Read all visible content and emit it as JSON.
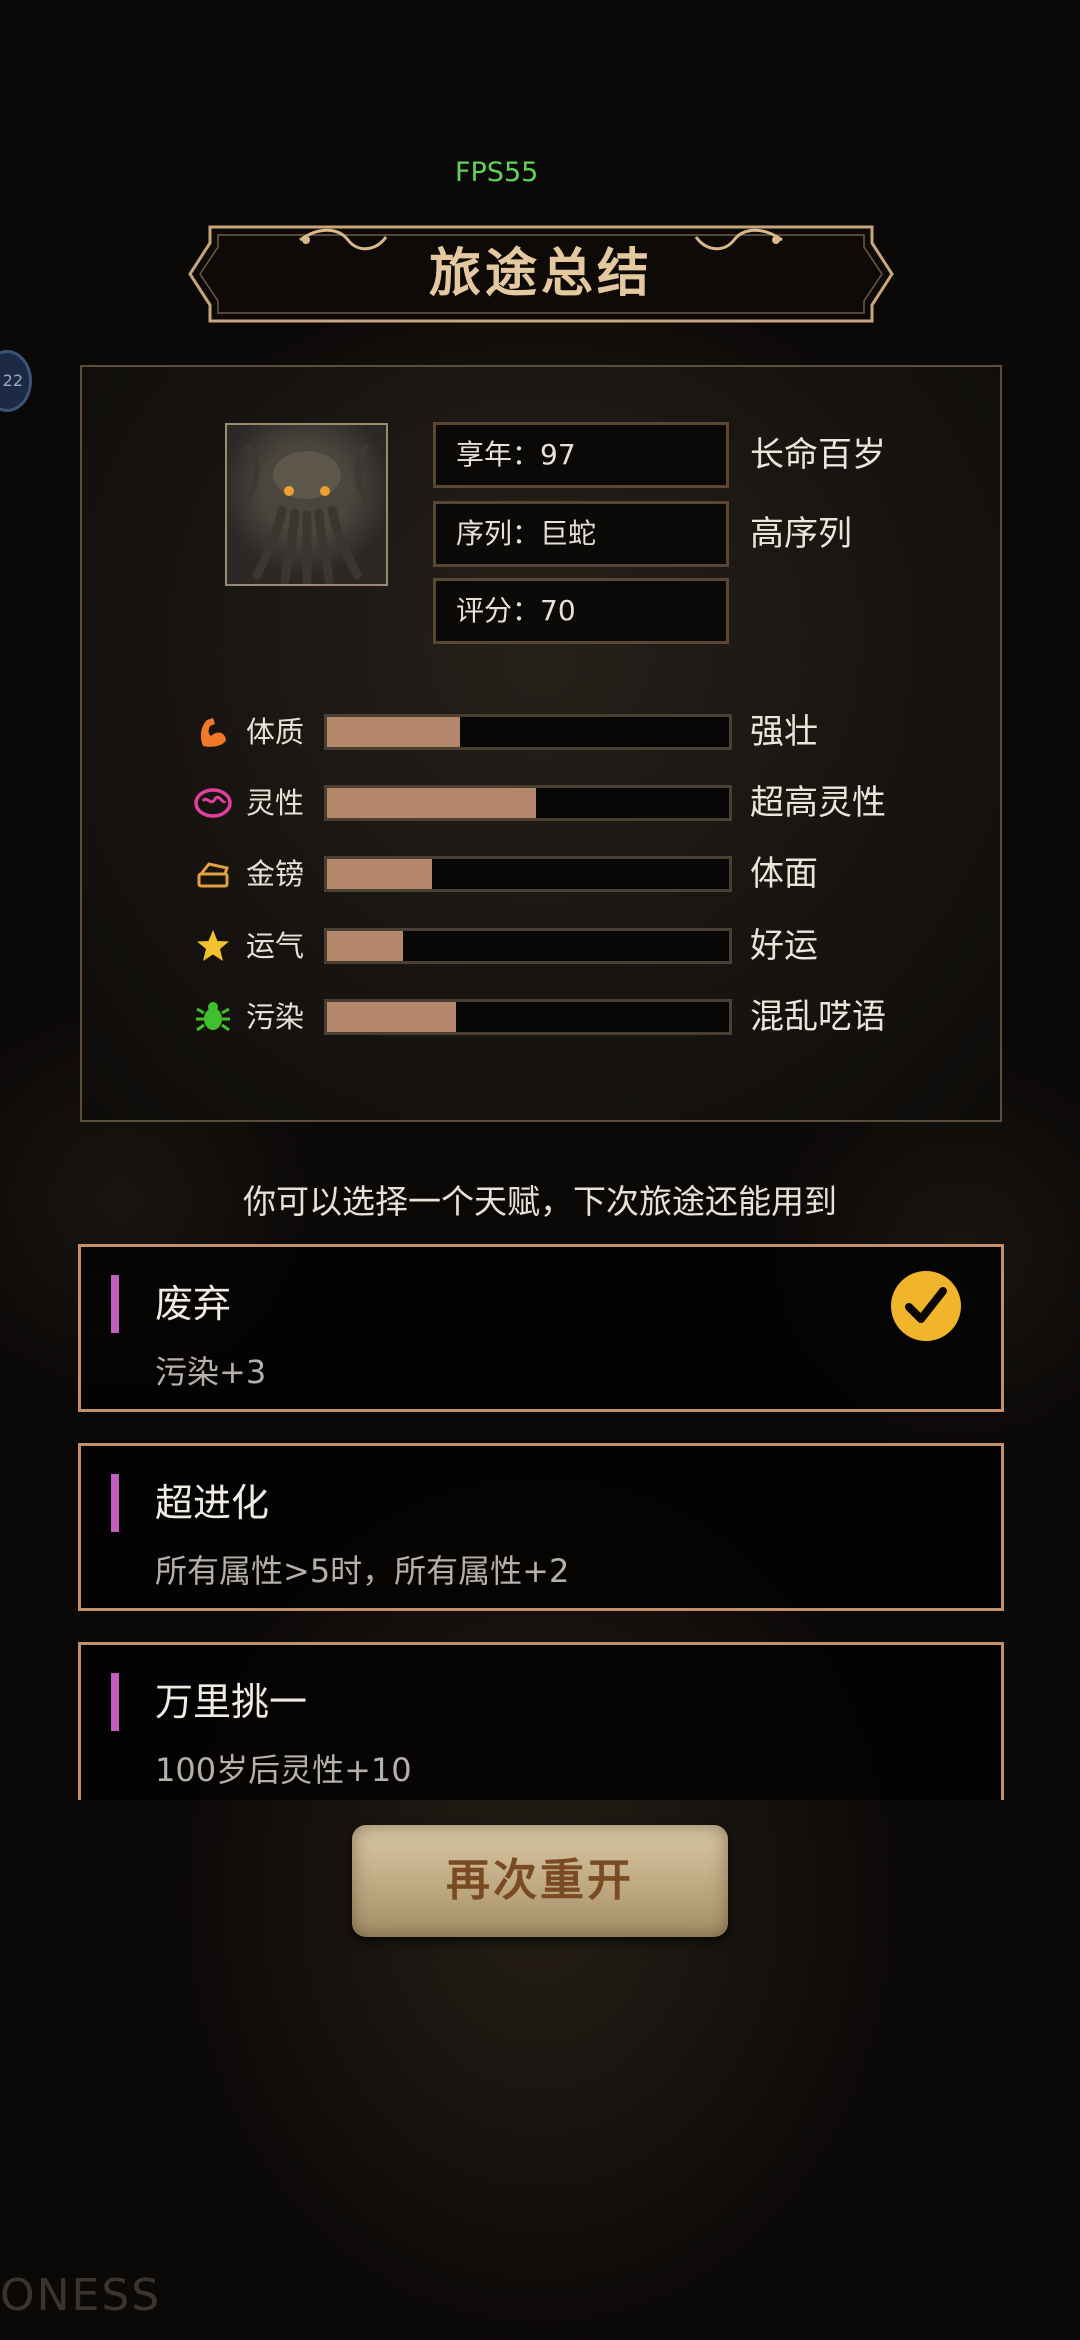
{
  "fps": "FPS55",
  "side_badge": "22",
  "title": "旅途总结",
  "summary": {
    "portrait_icon": "cthulhu-portrait",
    "info": [
      {
        "text": "享年：97",
        "tag": "长命百岁"
      },
      {
        "text": "序列：巨蛇",
        "tag": "高序列"
      },
      {
        "text": "评分：70",
        "tag": ""
      }
    ],
    "stats": [
      {
        "label": "体质",
        "icon": "muscle-icon",
        "icon_color": "#f07a2a",
        "fill": 0.33,
        "tag": "强壮"
      },
      {
        "label": "灵性",
        "icon": "brain-icon",
        "icon_color": "#e0409a",
        "fill": 0.52,
        "tag": "超高灵性"
      },
      {
        "label": "金镑",
        "icon": "money-icon",
        "icon_color": "#e0a040",
        "fill": 0.26,
        "tag": "体面"
      },
      {
        "label": "运气",
        "icon": "star-icon",
        "icon_color": "#f2c12e",
        "fill": 0.19,
        "tag": "好运"
      },
      {
        "label": "污染",
        "icon": "bug-icon",
        "icon_color": "#3fc02e",
        "fill": 0.32,
        "tag": "混乱呓语"
      }
    ]
  },
  "prompt": "你可以选择一个天赋，下次旅途还能用到",
  "talents": [
    {
      "name": "废弃",
      "desc": "污染+3",
      "selected": true
    },
    {
      "name": "超进化",
      "desc": "所有属性>5时，所有属性+2",
      "selected": false
    },
    {
      "name": "万里挑一",
      "desc": "100岁后灵性+10",
      "selected": false
    }
  ],
  "restart_label": "再次重开",
  "watermark": "ONESS",
  "colors": {
    "bar_fill": "#b4876a",
    "card_border": "#c4906a",
    "accent": "#c25fbe",
    "check": "#f1b52c"
  }
}
